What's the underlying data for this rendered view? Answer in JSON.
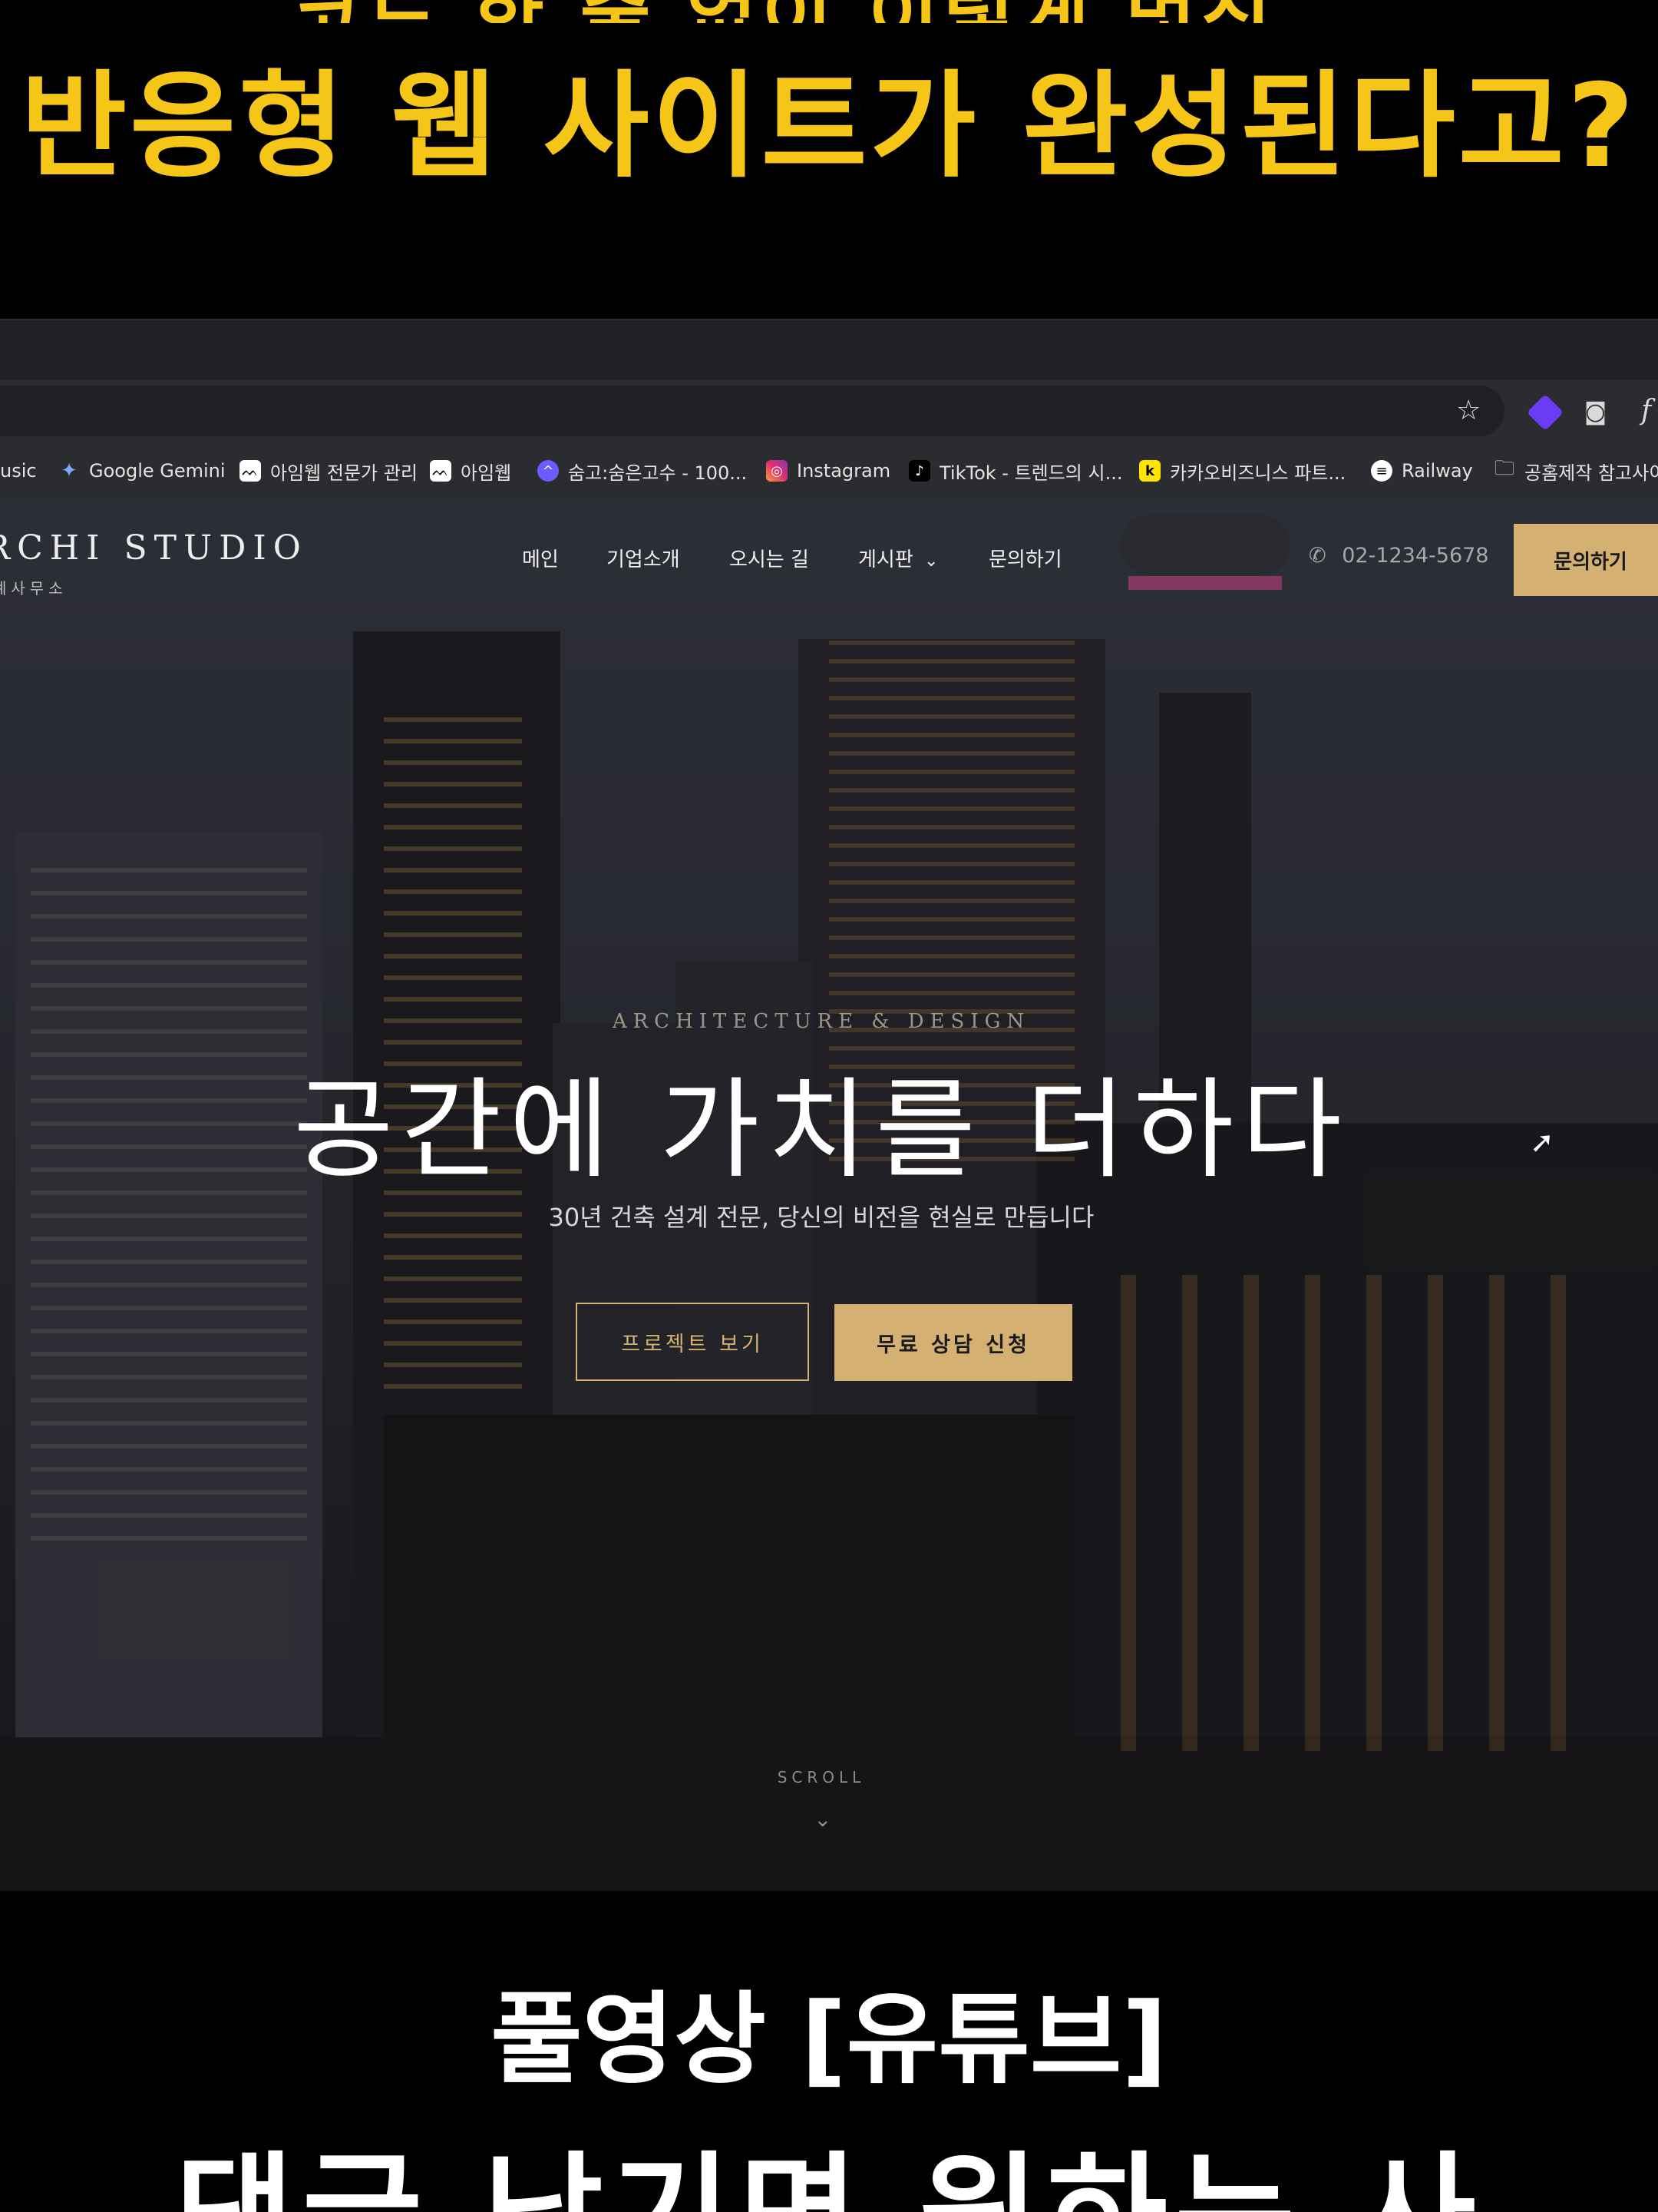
{
  "captions": {
    "top_clipped": "코드 한 줄 없이 이렇게 멋진",
    "headline": "반응형 웹 사이트가 완성된다고?",
    "bottom_1": "풀영상 [유튜브]",
    "bottom_2_clipped": "댓글 남기면 원하는 사"
  },
  "browser": {
    "bookmarks": [
      {
        "label": "usic",
        "icon": "music-icon"
      },
      {
        "label": "Google Gemini",
        "icon": "gemini-icon"
      },
      {
        "label": "아임웹 전문가 관리",
        "icon": "imweb-icon"
      },
      {
        "label": "아임웹",
        "icon": "imweb-icon"
      },
      {
        "label": "숨고:숨은고수 - 100...",
        "icon": "soomgo-icon"
      },
      {
        "label": "Instagram",
        "icon": "instagram-icon"
      },
      {
        "label": "TikTok - 트렌드의 시...",
        "icon": "tiktok-icon"
      },
      {
        "label": "카카오비즈니스 파트...",
        "icon": "kakao-icon"
      },
      {
        "label": "Railway",
        "icon": "railway-icon"
      },
      {
        "label": "공홈제작 참고사이",
        "icon": "folder-icon"
      }
    ],
    "toolbar_icons": [
      "star-icon",
      "extension-icon",
      "camera-icon",
      "f-icon"
    ]
  },
  "site": {
    "logo": "RCHI STUDIO",
    "logo_sub": "계사무소",
    "nav": [
      "메인",
      "기업소개",
      "오시는 길",
      "게시판",
      "문의하기"
    ],
    "phone": "02-1234-5678",
    "cta_top": "문의하기",
    "hero": {
      "eyebrow": "ARCHITECTURE & DESIGN",
      "headline": "공간에 가치를 더하다",
      "subline": "30년 건축 설계 전문, 당신의 비전을 현실로 만듭니다",
      "btn_projects": "프로젝트 보기",
      "btn_consult": "무료 상담 신청",
      "scroll": "SCROLL"
    }
  },
  "colors": {
    "caption_yellow": "#f5c518",
    "accent_gold": "#d4b072",
    "chrome_dark": "#2b2c30"
  }
}
